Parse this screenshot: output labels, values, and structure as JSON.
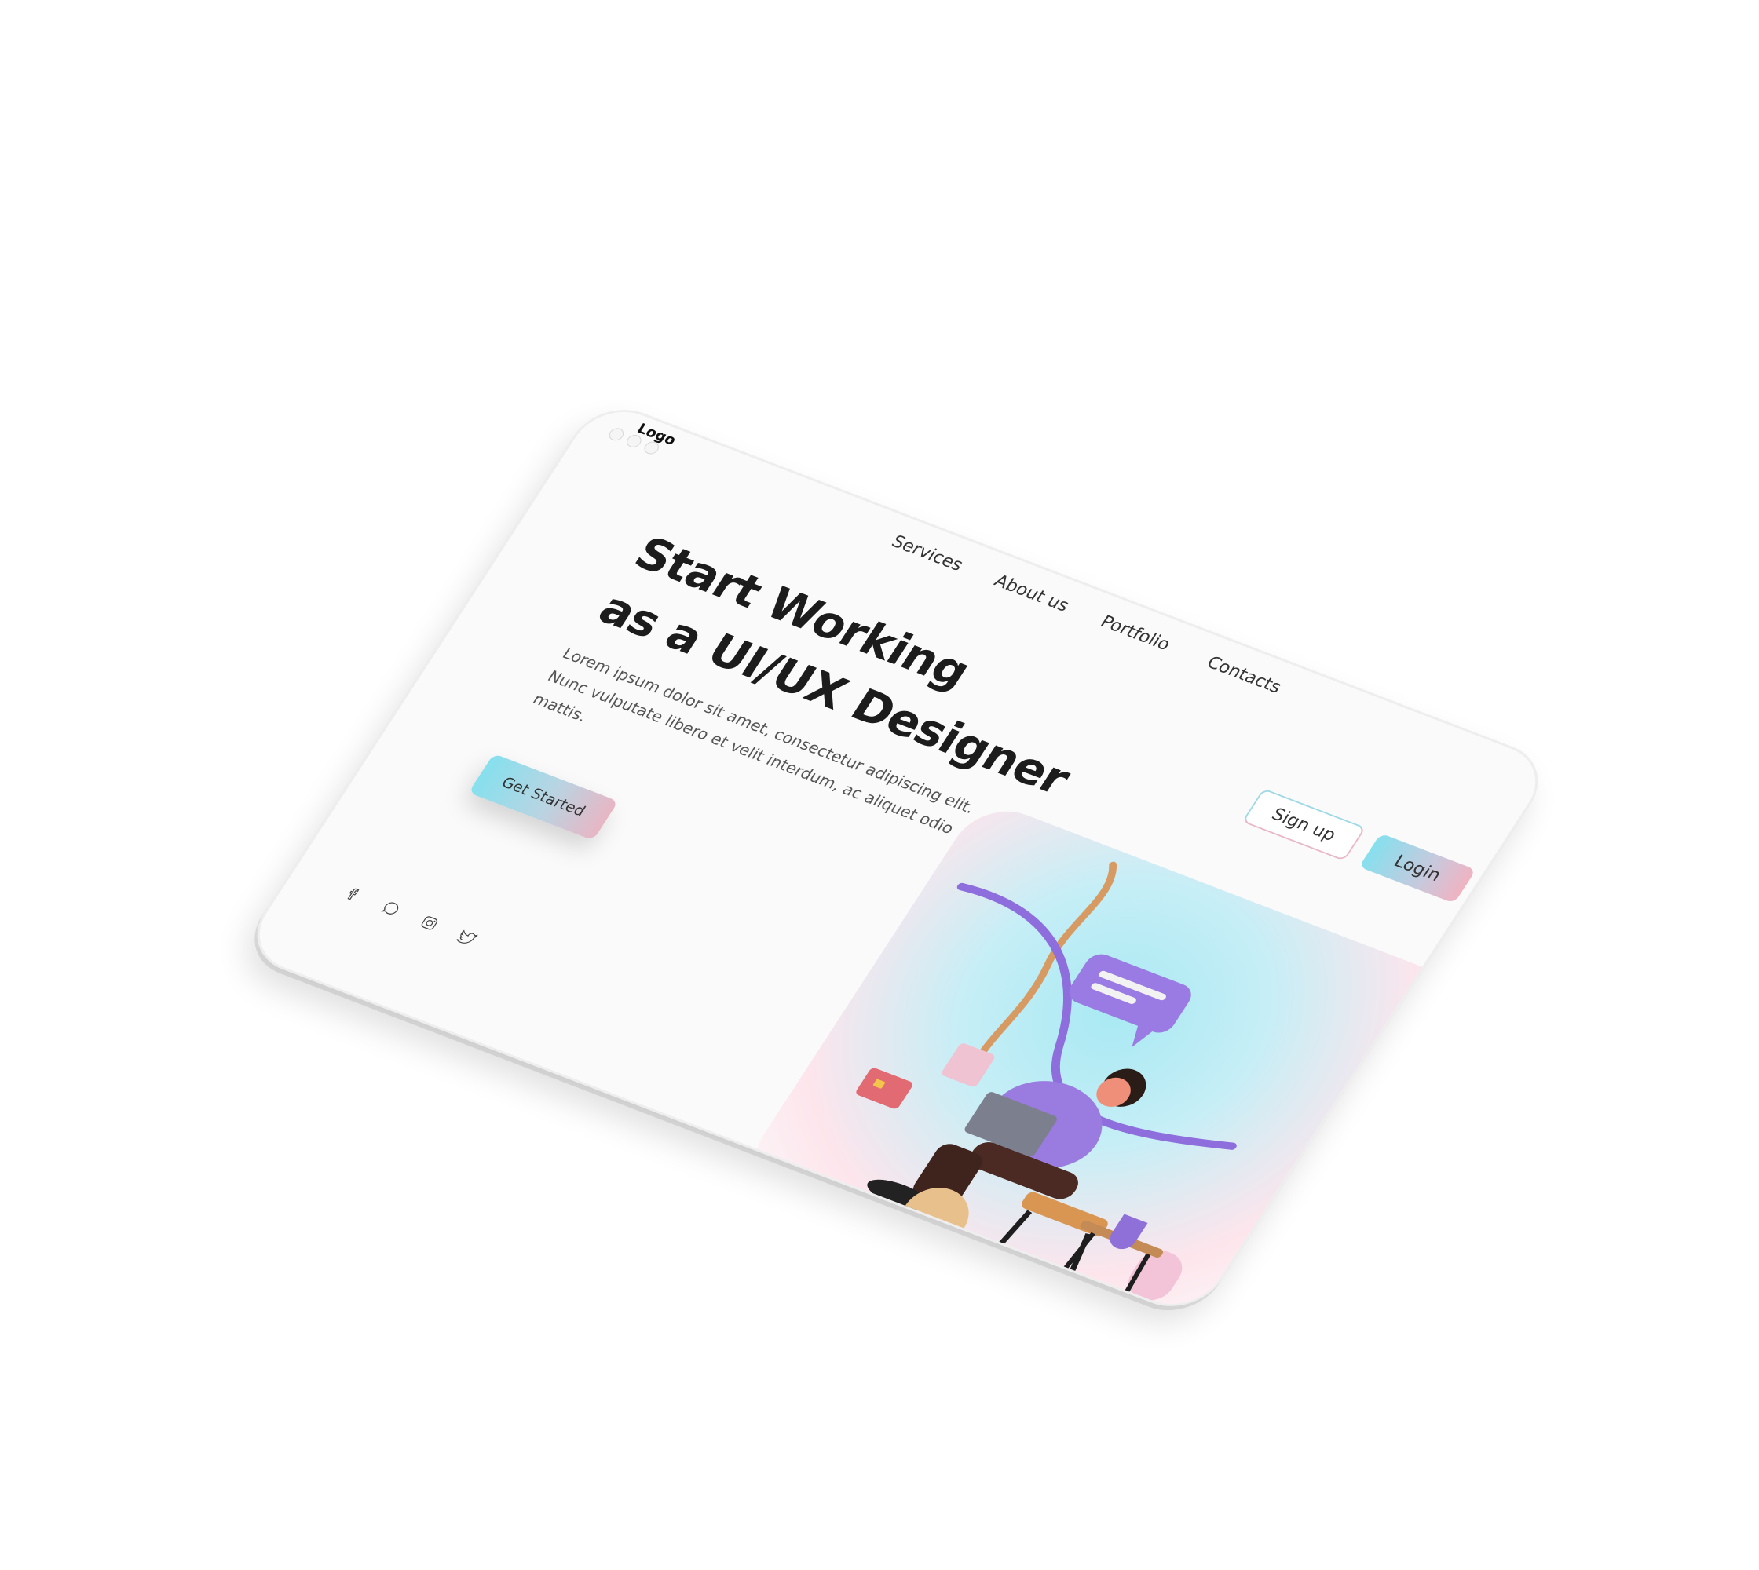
{
  "window": {
    "controls": [
      "close",
      "minimize",
      "maximize"
    ]
  },
  "header": {
    "logo": "Logo",
    "nav": [
      {
        "label": "Services"
      },
      {
        "label": "About us"
      },
      {
        "label": "Portfolio"
      },
      {
        "label": "Contacts"
      }
    ],
    "signup_label": "Sign up",
    "login_label": "Login"
  },
  "hero": {
    "title_line1": "Start Working",
    "title_line2": "as a UI/UX Designer",
    "description": "Lorem ipsum dolor sit amet, consectetur adipiscing elit. Nunc vulputate libero et velit interdum, ac aliquet odio mattis.",
    "cta_label": "Get Started"
  },
  "socials": [
    {
      "icon": "facebook-icon"
    },
    {
      "icon": "whatsapp-icon"
    },
    {
      "icon": "instagram-icon"
    },
    {
      "icon": "twitter-icon"
    }
  ],
  "illustration": {
    "subject": "person-with-laptop-illustration"
  },
  "colors": {
    "accent_cyan": "#86e0ee",
    "accent_pink": "#e8b6c4",
    "accent_purple": "#9b7be0",
    "text_dark": "#1c1c1c"
  }
}
